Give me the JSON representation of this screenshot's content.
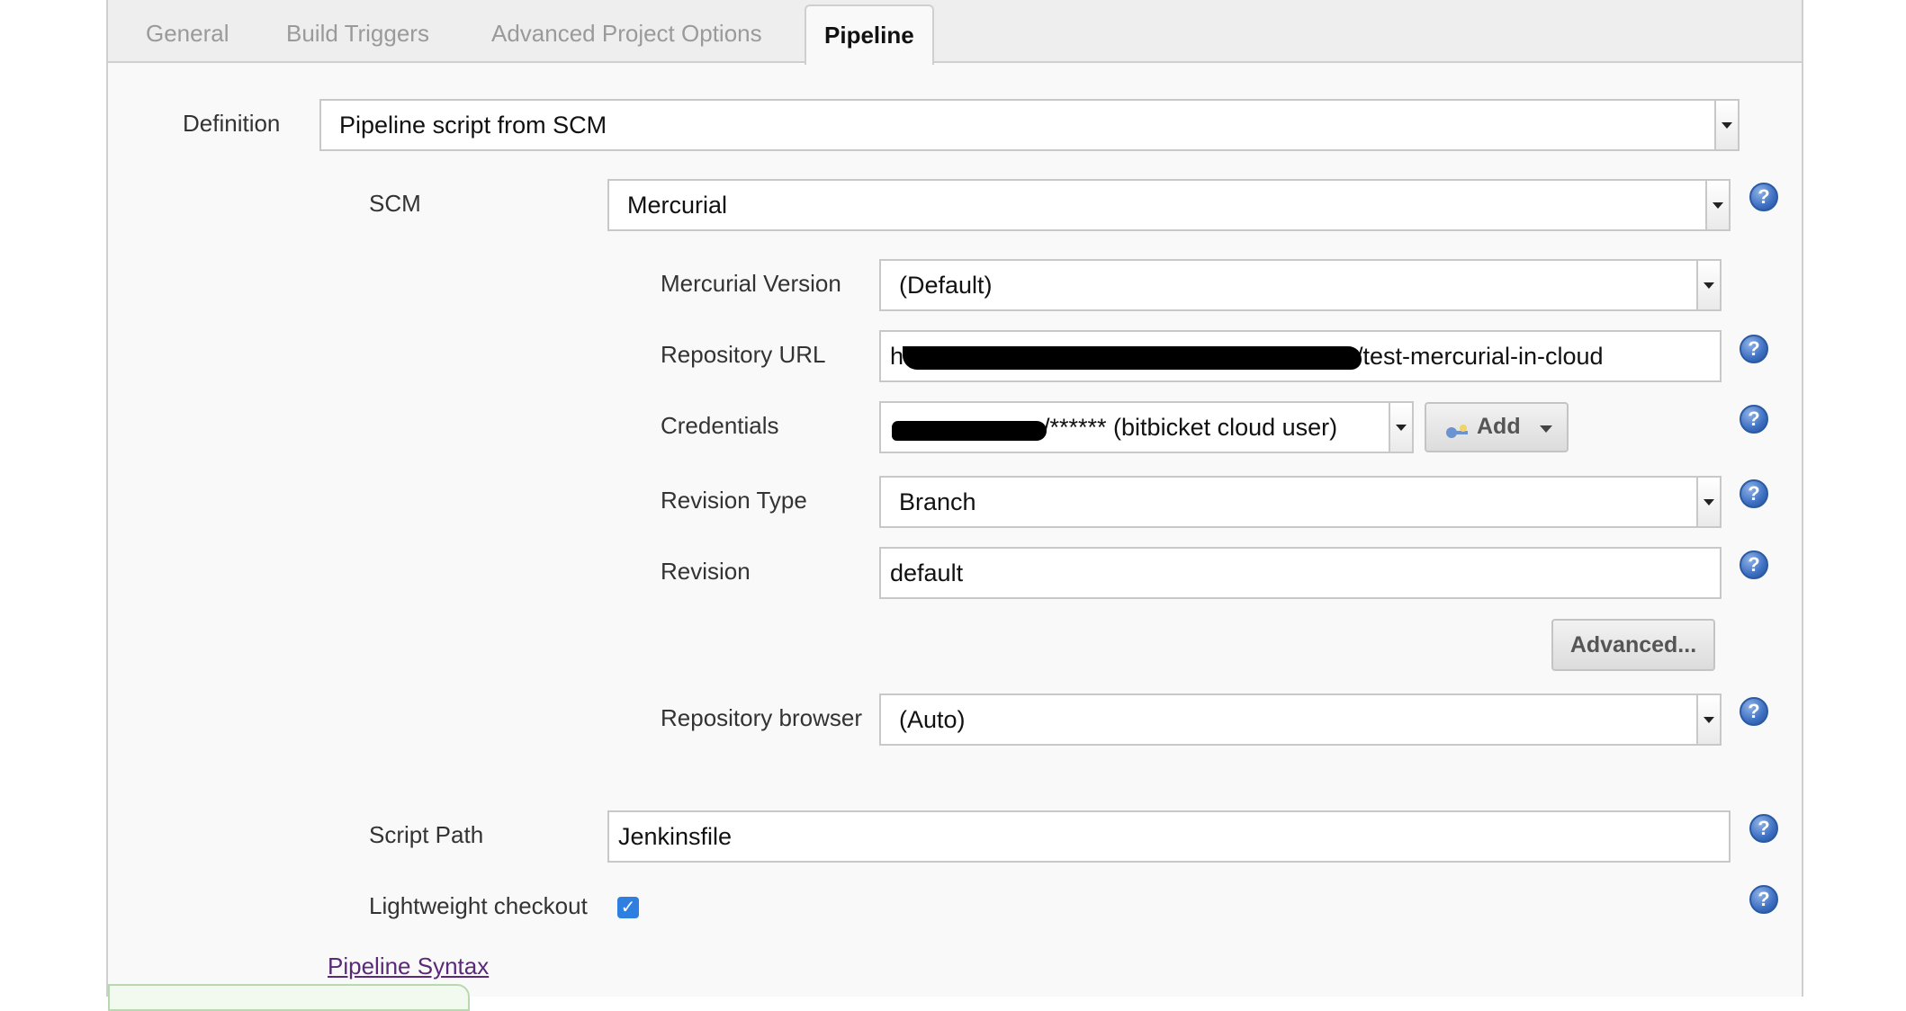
{
  "tabs": [
    {
      "label": "General",
      "active": false
    },
    {
      "label": "Build Triggers",
      "active": false
    },
    {
      "label": "Advanced Project Options",
      "active": false
    },
    {
      "label": "Pipeline",
      "active": true
    }
  ],
  "definition": {
    "label": "Definition",
    "value": "Pipeline script from SCM"
  },
  "scm": {
    "label": "SCM",
    "value": "Mercurial"
  },
  "mercurial_version": {
    "label": "Mercurial Version",
    "value": "(Default)"
  },
  "repository_url": {
    "label": "Repository URL",
    "value_prefix": "ht",
    "value_visible": "/test-mercurial-in-cloud"
  },
  "credentials": {
    "label": "Credentials",
    "value_visible": "/****** (bitbicket cloud user)",
    "add_button_label": "Add"
  },
  "revision_type": {
    "label": "Revision Type",
    "value": "Branch"
  },
  "revision": {
    "label": "Revision",
    "value": "default"
  },
  "advanced_button_label": "Advanced...",
  "repository_browser": {
    "label": "Repository browser",
    "value": "(Auto)"
  },
  "script_path": {
    "label": "Script Path",
    "value": "Jenkinsfile"
  },
  "lightweight_checkout": {
    "label": "Lightweight checkout",
    "checked": true
  },
  "pipeline_syntax_link": "Pipeline Syntax",
  "icons": {
    "help": "help-icon",
    "credentials_add": "key-icon",
    "checkmark": "checkmark-icon"
  },
  "colors": {
    "help_icon": "#3d6fc2",
    "checkbox": "#2f7fe0",
    "link": "#5a2a78",
    "panel_bg": "#f9f9f9",
    "tabbar_bg": "#eeeeee"
  }
}
